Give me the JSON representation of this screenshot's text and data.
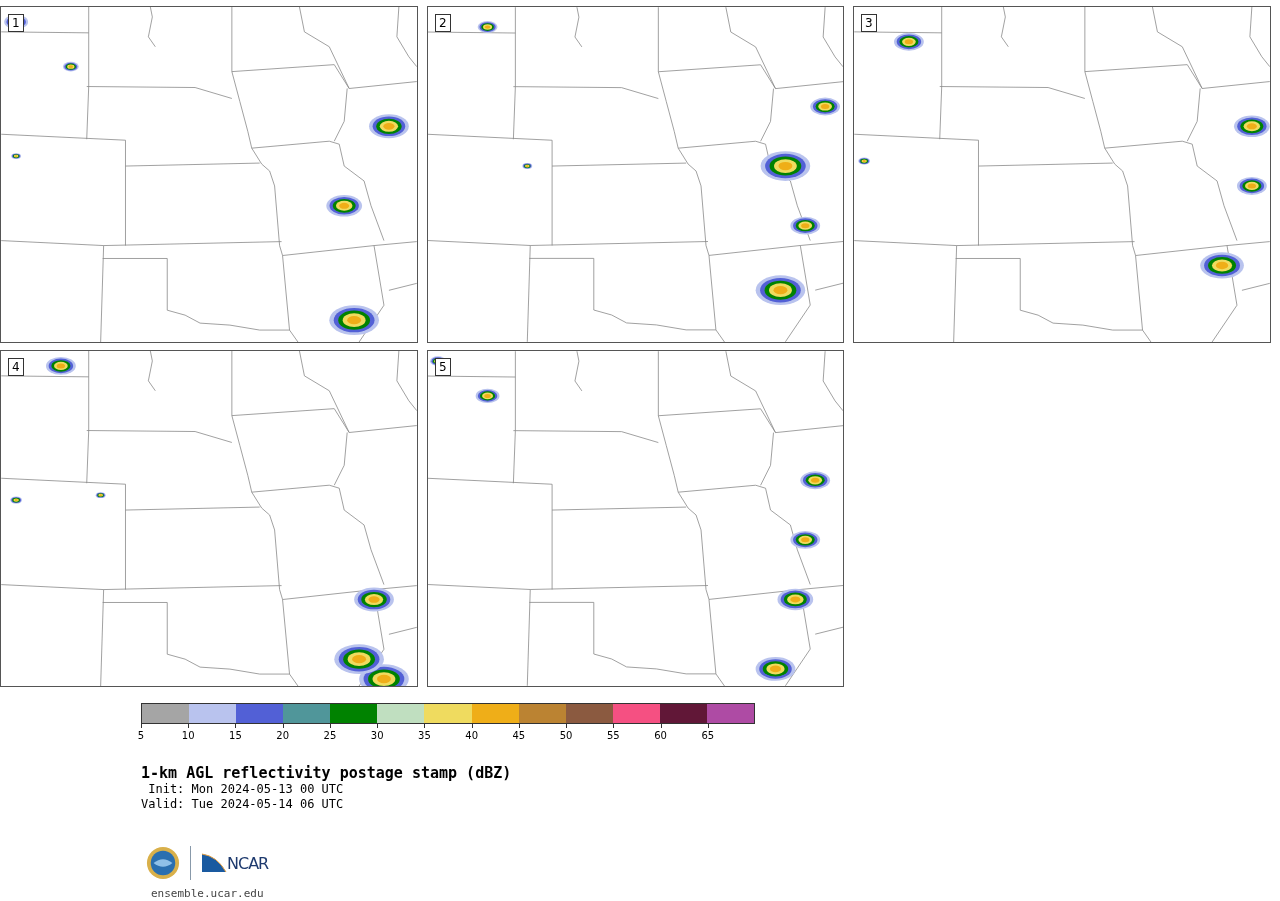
{
  "panels": [
    {
      "label": "1"
    },
    {
      "label": "2"
    },
    {
      "label": "3"
    },
    {
      "label": "4"
    },
    {
      "label": "5"
    }
  ],
  "colorbar": {
    "segments": [
      {
        "color": "#a5a5a5"
      },
      {
        "color": "#b9c3ee"
      },
      {
        "color": "#5260d6"
      },
      {
        "color": "#50969a"
      },
      {
        "color": "#008200"
      },
      {
        "color": "#c0dfc0"
      },
      {
        "color": "#efdb5f"
      },
      {
        "color": "#efae18"
      },
      {
        "color": "#bb8332"
      },
      {
        "color": "#8b5a40"
      },
      {
        "color": "#f55082"
      },
      {
        "color": "#611737"
      },
      {
        "color": "#ae4ba4"
      }
    ],
    "ticks": [
      "5",
      "10",
      "15",
      "20",
      "25",
      "30",
      "35",
      "40",
      "45",
      "50",
      "55",
      "60",
      "65"
    ]
  },
  "title": "1-km AGL reflectivity postage stamp (dBZ)",
  "init": " Init: Mon 2024-05-13 00 UTC",
  "valid": "Valid: Tue 2024-05-14 06 UTC",
  "logo_text": "NCAR",
  "url": "ensemble.ucar.edu"
}
